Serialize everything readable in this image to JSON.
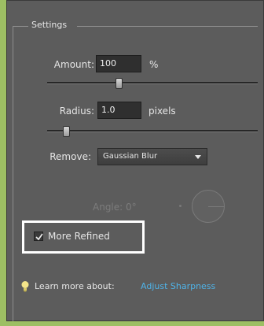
{
  "settings": {
    "legend": "Settings",
    "amount": {
      "label": "Amount:",
      "value": "100",
      "unit": "%",
      "slider_fraction": 0.34
    },
    "radius": {
      "label": "Radius:",
      "value": "1.0",
      "unit": "pixels",
      "slider_fraction": 0.09
    },
    "remove": {
      "label": "Remove:",
      "selected": "Gaussian Blur"
    },
    "angle": {
      "label": "Angle:",
      "value": "0",
      "degree_symbol": "°"
    },
    "more_refined": {
      "label": "More Refined",
      "checked": true
    }
  },
  "help": {
    "prefix": "Learn more about:",
    "link": "Adjust Sharpness"
  },
  "colors": {
    "panel_bg": "#5c5c5c",
    "frame_green": "#9dbf63",
    "highlight_border": "#ffffff",
    "link": "#4fb3e8"
  }
}
